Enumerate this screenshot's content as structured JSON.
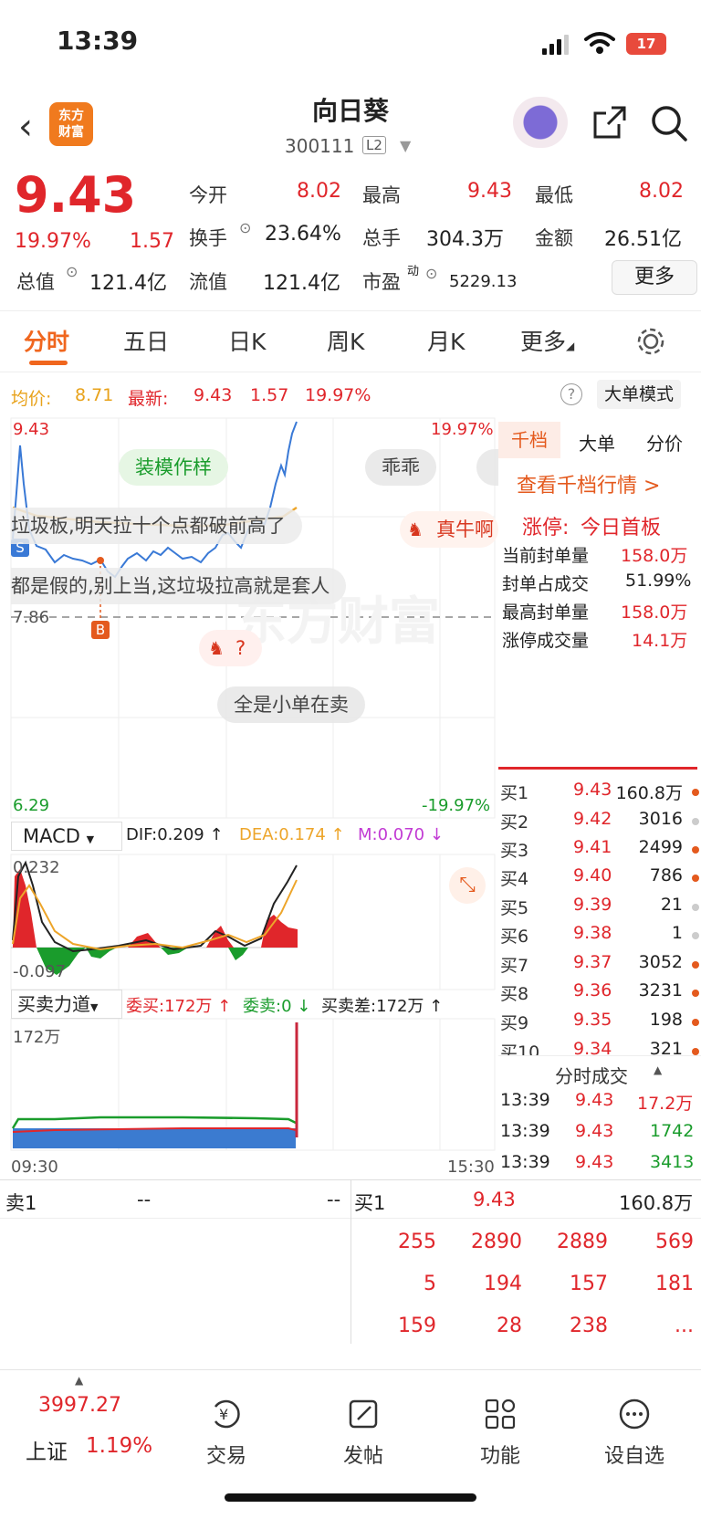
{
  "status_bar": {
    "time": "13:39",
    "battery": "17"
  },
  "header": {
    "logo_line1": "东方",
    "logo_line2": "财富",
    "stock_name": "向日葵",
    "stock_code": "300111",
    "level": "L2"
  },
  "quote": {
    "price": "9.43",
    "change_pct": "19.97%",
    "change": "1.57",
    "open_label": "今开",
    "open": "8.02",
    "high_label": "最高",
    "high": "9.43",
    "low_label": "最低",
    "low": "8.02",
    "turnover_label": "换手",
    "turnover": "23.64%",
    "volume_label": "总手",
    "volume": "304.3万",
    "amount_label": "金额",
    "amount": "26.51亿",
    "mktcap_label": "总值",
    "mktcap": "121.4亿",
    "float_label": "流值",
    "float": "121.4亿",
    "pe_label": "市盈",
    "pe_sup": "动",
    "pe": "5229.13",
    "more_label": "更多"
  },
  "tabs": [
    "分时",
    "五日",
    "日K",
    "周K",
    "月K",
    "更多"
  ],
  "intraday": {
    "avg_label": "均价:",
    "avg": "8.71",
    "latest_label": "最新:",
    "latest": "9.43",
    "latest_chg": "1.57",
    "latest_pct": "19.97%",
    "big_order_mode": "大单模式",
    "y_top": "9.43",
    "y_top_pct": "19.97%",
    "y_mid": "7.86",
    "y_bottom": "6.29",
    "y_bottom_pct": "-19.97%",
    "marker_s": "S",
    "marker_b": "B",
    "bubbles": [
      "装模作样",
      "乖乖",
      "垃圾板,明天拉十个点都破前高了",
      "真牛啊",
      "都是假的,别上当,这垃圾拉高就是套人",
      "?",
      "全是小单在卖"
    ],
    "watermark": "东方财富"
  },
  "macd": {
    "name": "MACD",
    "dif": "DIF:0.209 ↑",
    "dea": "DEA:0.174 ↑",
    "m": "M:0.070 ↓",
    "y_top": "0.232",
    "y_bottom": "-0.097"
  },
  "power": {
    "name": "买卖力道",
    "buy": "委买:172万 ↑",
    "sell": "委卖:0 ↓",
    "diff": "买卖差:172万 ↑",
    "y_top": "172万",
    "time_start": "09:30",
    "time_end": "15:30"
  },
  "right_panel": {
    "tabs": [
      "千档",
      "大单",
      "分价"
    ],
    "view_full": "查看千档行情 >",
    "limit_up_label": "涨停:",
    "limit_up_value": "今日首板",
    "stats": [
      {
        "label": "当前封单量",
        "value": "158.0万"
      },
      {
        "label": "封单占成交",
        "value": "51.99%"
      },
      {
        "label": "最高封单量",
        "value": "158.0万"
      },
      {
        "label": "涨停成交量",
        "value": "14.1万"
      }
    ],
    "bids": [
      {
        "label": "买1",
        "price": "9.43",
        "vol": "160.8万"
      },
      {
        "label": "买2",
        "price": "9.42",
        "vol": "3016"
      },
      {
        "label": "买3",
        "price": "9.41",
        "vol": "2499"
      },
      {
        "label": "买4",
        "price": "9.40",
        "vol": "786"
      },
      {
        "label": "买5",
        "price": "9.39",
        "vol": "21"
      },
      {
        "label": "买6",
        "price": "9.38",
        "vol": "1"
      },
      {
        "label": "买7",
        "price": "9.37",
        "vol": "3052"
      },
      {
        "label": "买8",
        "price": "9.36",
        "vol": "3231"
      },
      {
        "label": "买9",
        "price": "9.35",
        "vol": "198"
      },
      {
        "label": "买10",
        "price": "9.34",
        "vol": "321"
      }
    ],
    "ticks_title": "分时成交",
    "ticks": [
      {
        "time": "13:39",
        "price": "9.43",
        "vol": "17.2万"
      },
      {
        "time": "13:39",
        "price": "9.43",
        "vol": "1742"
      },
      {
        "time": "13:39",
        "price": "9.43",
        "vol": "3413"
      }
    ]
  },
  "level2": {
    "sell1_label": "卖1",
    "sell1_price": "--",
    "sell1_vol": "--",
    "buy1_label": "买1",
    "buy1_price": "9.43",
    "buy1_vol": "160.8万",
    "queue": [
      [
        "255",
        "2890",
        "2889",
        "569"
      ],
      [
        "5",
        "194",
        "157",
        "181"
      ],
      [
        "159",
        "28",
        "238",
        "..."
      ]
    ]
  },
  "bottom_nav": {
    "index_value": "3997.27",
    "index_name": "上证",
    "index_pct": "1.19%",
    "items": [
      "交易",
      "发帖",
      "功能",
      "设自选"
    ]
  }
}
